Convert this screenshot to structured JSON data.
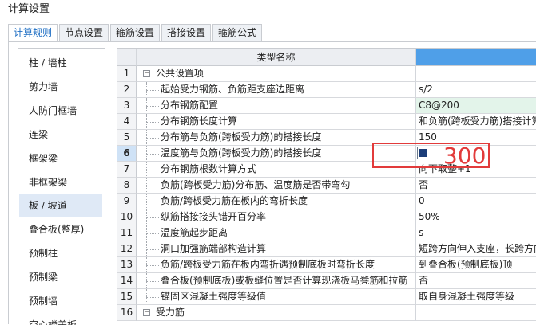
{
  "window": {
    "title": "计算设置"
  },
  "tabs": [
    {
      "label": "计算规则",
      "active": true
    },
    {
      "label": "节点设置",
      "active": false
    },
    {
      "label": "箍筋设置",
      "active": false
    },
    {
      "label": "搭接设置",
      "active": false
    },
    {
      "label": "箍筋公式",
      "active": false
    }
  ],
  "sidebar": {
    "items": [
      {
        "label": "柱 / 墙柱"
      },
      {
        "label": "剪力墙"
      },
      {
        "label": "人防门框墙"
      },
      {
        "label": "连梁"
      },
      {
        "label": "框架梁"
      },
      {
        "label": "非框架梁"
      },
      {
        "label": "板 / 坡道",
        "active": true
      },
      {
        "label": "叠合板(整厚)"
      },
      {
        "label": "预制柱"
      },
      {
        "label": "预制梁"
      },
      {
        "label": "预制墙"
      },
      {
        "label": "空心楼盖板"
      }
    ]
  },
  "grid": {
    "columns": {
      "name": "类型名称",
      "value": ""
    },
    "rows": [
      {
        "num": "1",
        "name": "公共设置项",
        "value": "",
        "group": true,
        "expander": "−"
      },
      {
        "num": "2",
        "name": "起始受力钢筋、负筋距支座边距离",
        "value": "s/2"
      },
      {
        "num": "3",
        "name": "分布钢筋配置",
        "value": "C8@200",
        "highlight": true
      },
      {
        "num": "4",
        "name": "分布钢筋长度计算",
        "value": "和负筋(跨板受力筋)搭接计算"
      },
      {
        "num": "5",
        "name": "分布筋与负筋(跨板受力筋)的搭接长度",
        "value": "150"
      },
      {
        "num": "6",
        "name": "温度筋与负筋(跨板受力筋)的搭接长度",
        "value": "",
        "selected": true
      },
      {
        "num": "7",
        "name": "分布钢筋根数计算方式",
        "value": "向下取整+1"
      },
      {
        "num": "8",
        "name": "负筋(跨板受力筋)分布筋、温度筋是否带弯勾",
        "value": "否"
      },
      {
        "num": "9",
        "name": "负筋/跨板受力筋在板内的弯折长度",
        "value": "0"
      },
      {
        "num": "10",
        "name": "纵筋搭接接头错开百分率",
        "value": "50%"
      },
      {
        "num": "11",
        "name": "温度筋起步距离",
        "value": "s"
      },
      {
        "num": "12",
        "name": "洞口加强筋端部构造计算",
        "value": "短跨方向伸入支座，长跨方向"
      },
      {
        "num": "13",
        "name": "负筋/跨板受力筋在板内弯折遇预制底板时弯折长度",
        "value": "到叠合板(预制底板)顶"
      },
      {
        "num": "14",
        "name": "叠合板(预制底板)或板缝位置是否计算现浇板马凳筋和拉筋",
        "value": "否"
      },
      {
        "num": "15",
        "name": "锚固区混凝土强度等级值",
        "value": "取自身混凝土强度等级"
      },
      {
        "num": "16",
        "name": "受力筋",
        "value": "",
        "group": true,
        "expander": "−"
      }
    ]
  },
  "annotation": {
    "text": "300",
    "color": "#e23b3b"
  }
}
